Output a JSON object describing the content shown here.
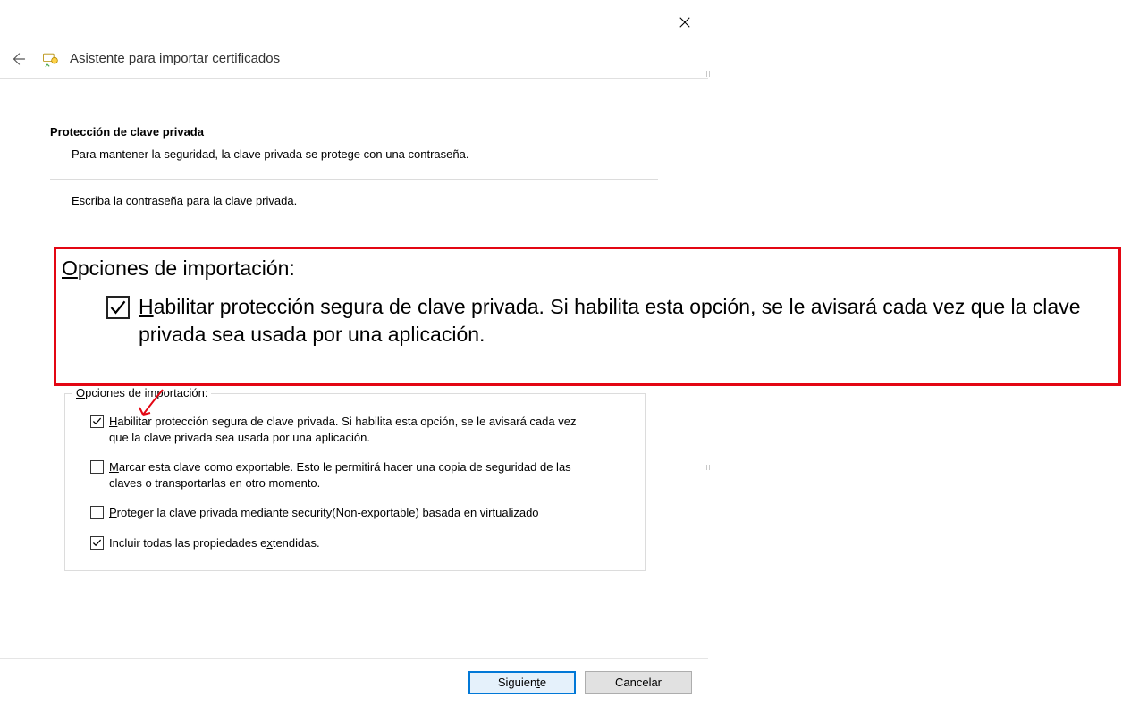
{
  "window": {
    "title": "Asistente para importar certificados"
  },
  "section": {
    "title": "Protección de clave privada",
    "desc": "Para mantener la seguridad, la clave privada se protege con una contraseña.",
    "cut_text": "Escriba la contraseña para la clave privada."
  },
  "callout": {
    "title_pre": "O",
    "title_rest": "pciones de importación:",
    "checkbox_pre": "H",
    "checkbox_rest": "abilitar protección segura de clave privada. Si habilita esta opción, se le avisará cada vez que la clave privada sea usada por una aplicación.",
    "checked": true
  },
  "group": {
    "legend_pre": "O",
    "legend_rest": "pciones de importación:",
    "options": [
      {
        "checked": true,
        "ul": "H",
        "rest": "abilitar protección segura de clave privada. Si habilita esta opción, se le avisará cada vez que la clave privada sea usada por una aplicación."
      },
      {
        "checked": false,
        "ul": "M",
        "rest": "arcar esta clave como exportable. Esto le permitirá hacer una copia de seguridad de las claves o transportarlas en otro momento."
      },
      {
        "checked": false,
        "ul": "P",
        "rest": "roteger la clave privada mediante security(Non-exportable) basada en virtualizado"
      },
      {
        "checked": true,
        "ul": "",
        "rest": "Incluir todas las propiedades e",
        "ul2": "x",
        "rest2": "tendidas."
      }
    ]
  },
  "buttons": {
    "next_pre": "Siguien",
    "next_ul": "t",
    "next_post": "e",
    "cancel": "Cancelar"
  }
}
